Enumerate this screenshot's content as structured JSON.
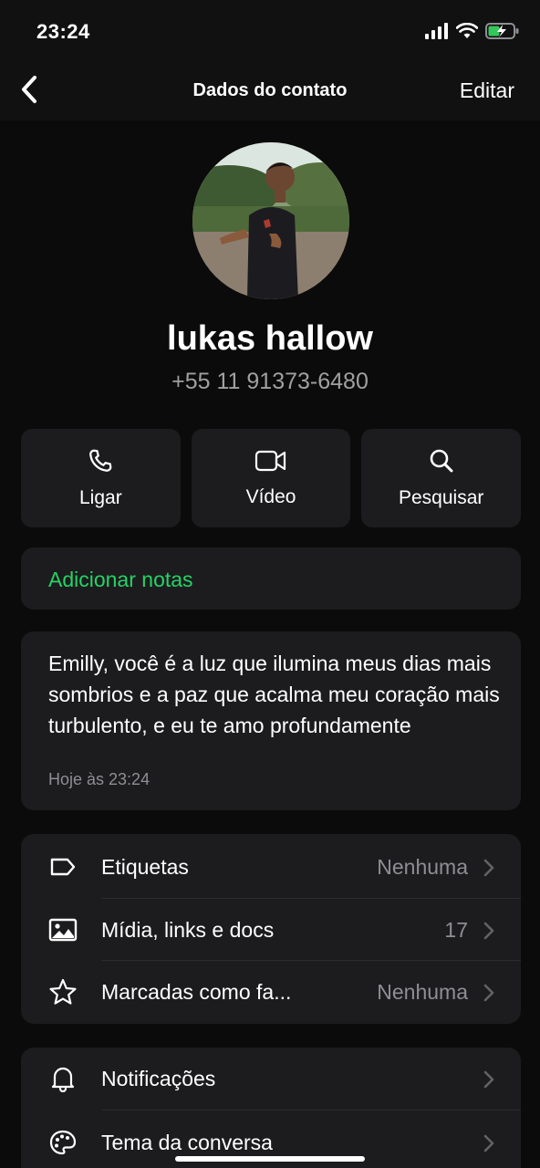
{
  "status_bar": {
    "time": "23:24"
  },
  "nav": {
    "title": "Dados do contato",
    "edit_label": "Editar"
  },
  "contact": {
    "name": "lukas hallow",
    "phone": "+55 11 91373-6480"
  },
  "actions": [
    {
      "label": "Ligar",
      "icon": "phone-icon"
    },
    {
      "label": "Vídeo",
      "icon": "video-icon"
    },
    {
      "label": "Pesquisar",
      "icon": "search-icon"
    }
  ],
  "notes": {
    "label": "Adicionar notas",
    "color": "#25d366"
  },
  "about": {
    "text": "Emilly, você é a luz que ilumina meus dias mais sombrios e a paz que acalma meu coração mais turbulento, e eu te amo profundamente",
    "timestamp": "Hoje às 23:24"
  },
  "list1": [
    {
      "label": "Etiquetas",
      "value": "Nenhuma",
      "icon": "tag-icon"
    },
    {
      "label": "Mídia, links e docs",
      "value": "17",
      "icon": "image-icon"
    },
    {
      "label": "Marcadas como fa...",
      "value": "Nenhuma",
      "icon": "star-icon"
    }
  ],
  "list2": [
    {
      "label": "Notificações",
      "icon": "bell-icon"
    },
    {
      "label": "Tema da conversa",
      "icon": "palette-icon"
    }
  ]
}
